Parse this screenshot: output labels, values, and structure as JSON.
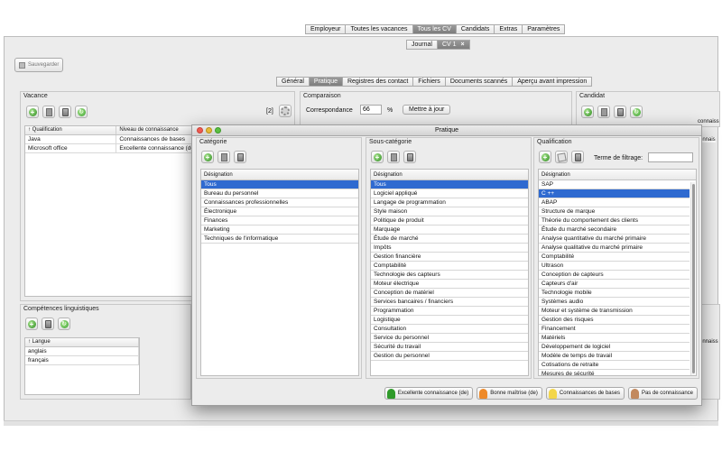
{
  "main_tabs": [
    "Employeur",
    "Toutes les vacances",
    "Tous les CV",
    "Candidats",
    "Extras",
    "Paramètres"
  ],
  "main_tabs_selected": 2,
  "doc_tabs": [
    "Journal",
    "CV 1"
  ],
  "doc_tab_close": "×",
  "save_label": "Sauvegarder",
  "sub_tabs": [
    "Général",
    "Pratique",
    "Registres des contact",
    "Fichiers",
    "Documents scannés",
    "Aperçu avant impression"
  ],
  "sub_tabs_selected": 1,
  "vacance": {
    "title": "Vacance",
    "counter": "[2]",
    "columns": [
      "↑ Qualification",
      "Niveau de connaissance"
    ],
    "rows": [
      [
        "Java",
        "Connaissances de bases"
      ],
      [
        "Microsoft office",
        "Excellente connaissance (de)"
      ]
    ]
  },
  "comparaison": {
    "title": "Comparaison",
    "label": "Correspondance",
    "value": "66",
    "unit": "%",
    "button": "Mettre à jour"
  },
  "candidat": {
    "title": "Candidat",
    "partial_header": "connaiss",
    "partial_row": "connais"
  },
  "langues": {
    "title": "Compétences linguistiques",
    "column": "↑ Langue",
    "rows": [
      "anglais",
      "français"
    ]
  },
  "right_partial": {
    "header": "onnaiss"
  },
  "dialog": {
    "title": "Pratique",
    "categorie": {
      "title": "Catégorie",
      "header": "Désignation",
      "selected": 0,
      "items": [
        "Tous",
        "Bureau du personnel",
        "Connaissances professionnelles",
        "Électronique",
        "Finances",
        "Marketing",
        "Techniques de l'informatique"
      ]
    },
    "sous_categorie": {
      "title": "Sous-catégorie",
      "header": "Désignation",
      "selected": 0,
      "items": [
        "Tous",
        "Logiciel appliqué",
        "Langage de programmation",
        "Style maison",
        "Politique de produit",
        "Marquage",
        "Étude de marché",
        "Impôts",
        "Gestion financière",
        "Comptabilité",
        "Technologie des capteurs",
        "Moteur électrique",
        "Conception de matériel",
        "Services bancaires / financiers",
        "Programmation",
        "Logistique",
        "Consultation",
        "Service du personnel",
        "Sécurité du travail",
        "Gestion du personnel"
      ]
    },
    "qualification": {
      "title": "Qualification",
      "filter_label": "Terme de filtrage:",
      "filter_value": "",
      "header": "Désignation",
      "selected": 1,
      "items": [
        "SAP",
        "C ++",
        "ABAP",
        "Structure de marque",
        "Théorie du comportement des clients",
        "Étude du marché secondaire",
        "Analyse quantitative du marché primaire",
        "Analyse qualitative du marché primaire",
        "Comptabilité",
        "Ultrason",
        "Conception de capteurs",
        "Capteurs d'air",
        "Technologie mobile",
        "Systèmes audio",
        "Moteur et système de transmission",
        "Gestion des risques",
        "Financement",
        "Matériels",
        "Développement de logiciel",
        "Modèle de temps de travail",
        "Cotisations de retraite",
        "Mesures de sécurité"
      ]
    },
    "legend": [
      {
        "label": "Excellente connaissance (de)",
        "color": "#2f9a2a"
      },
      {
        "label": "Bonne maîtrise (de)",
        "color": "#ee8a2a"
      },
      {
        "label": "Connaissances de bases",
        "color": "#f3d64a"
      },
      {
        "label": "Pas de connaissance",
        "color": "#c2895e"
      }
    ]
  },
  "colors": {
    "selection": "#2f6ad0",
    "close_light": "#ee5b50",
    "min_light": "#e6b93a",
    "zoom_light": "#5cbf43"
  }
}
